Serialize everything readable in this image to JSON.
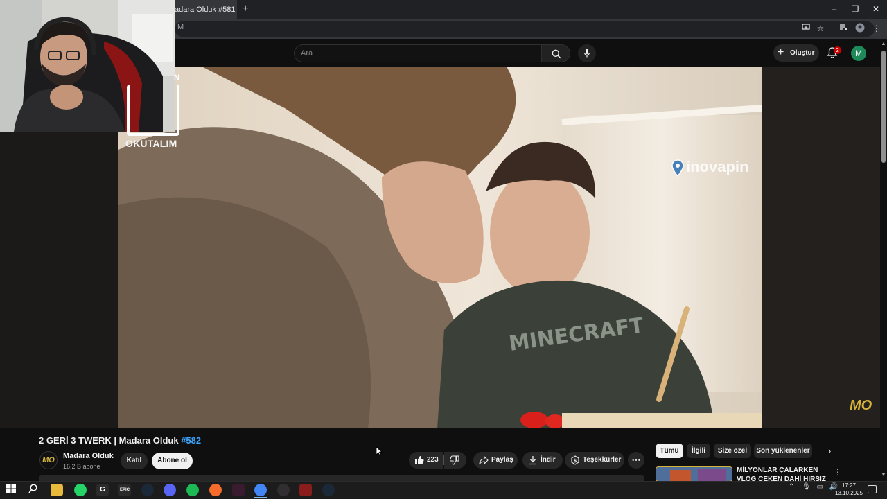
{
  "browser": {
    "tab_title": "adara Olduk #581",
    "tab_close": "×",
    "new_tab": "+",
    "url_fragment": "M",
    "window_controls": {
      "minimize": "–",
      "maximize": "❐",
      "close": "✕"
    }
  },
  "youtube": {
    "search_placeholder": "Ara",
    "create_label": "Oluştur",
    "notifications_count": "2",
    "avatar_letter": "M"
  },
  "video_overlay": {
    "okutalim": "OKUTALIM",
    "frame_letter": "N",
    "watermark": "inovapin",
    "corner_logo": "MO"
  },
  "video": {
    "title_main": "2 GERİ 3 TWERK | Madara Olduk ",
    "title_hashtag": "#582",
    "channel_name": "Madara Olduk",
    "channel_subscribers": "16,2 B abone",
    "channel_avatar_text": "MO",
    "join_label": "Katıl",
    "subscribe_label": "Abone ol",
    "like_count": "223",
    "share_label": "Paylaş",
    "download_label": "İndir",
    "thanks_label": "Teşekkürler",
    "more_label": "⋯"
  },
  "recommendations": {
    "chips": [
      "Tümü",
      "İlgili",
      "Size özel",
      "Son yüklenenler"
    ],
    "active_chip": "Tümü",
    "next_arrow": "›",
    "first_title": "MİLYONLAR ÇALARKEN VLOG ÇEKEN DAHİ HIRSIZ",
    "menu": "⋮"
  },
  "taskbar": {
    "time": "17:27",
    "date": "13.10.2025",
    "apps": [
      "start",
      "search",
      "file-explorer",
      "whatsapp",
      "g-app",
      "epic-games",
      "steam",
      "discord",
      "spotify",
      "origin",
      "twitch-app",
      "chrome",
      "obs",
      "winrar",
      "steam-2"
    ],
    "epic_label": "EPIC"
  },
  "colors": {
    "bg": "#0f0f0f",
    "accent_link": "#3ea6ff",
    "notification_red": "#cc0000",
    "avatar_green": "#1e8a5a",
    "logo_gold": "#d4b33a"
  }
}
